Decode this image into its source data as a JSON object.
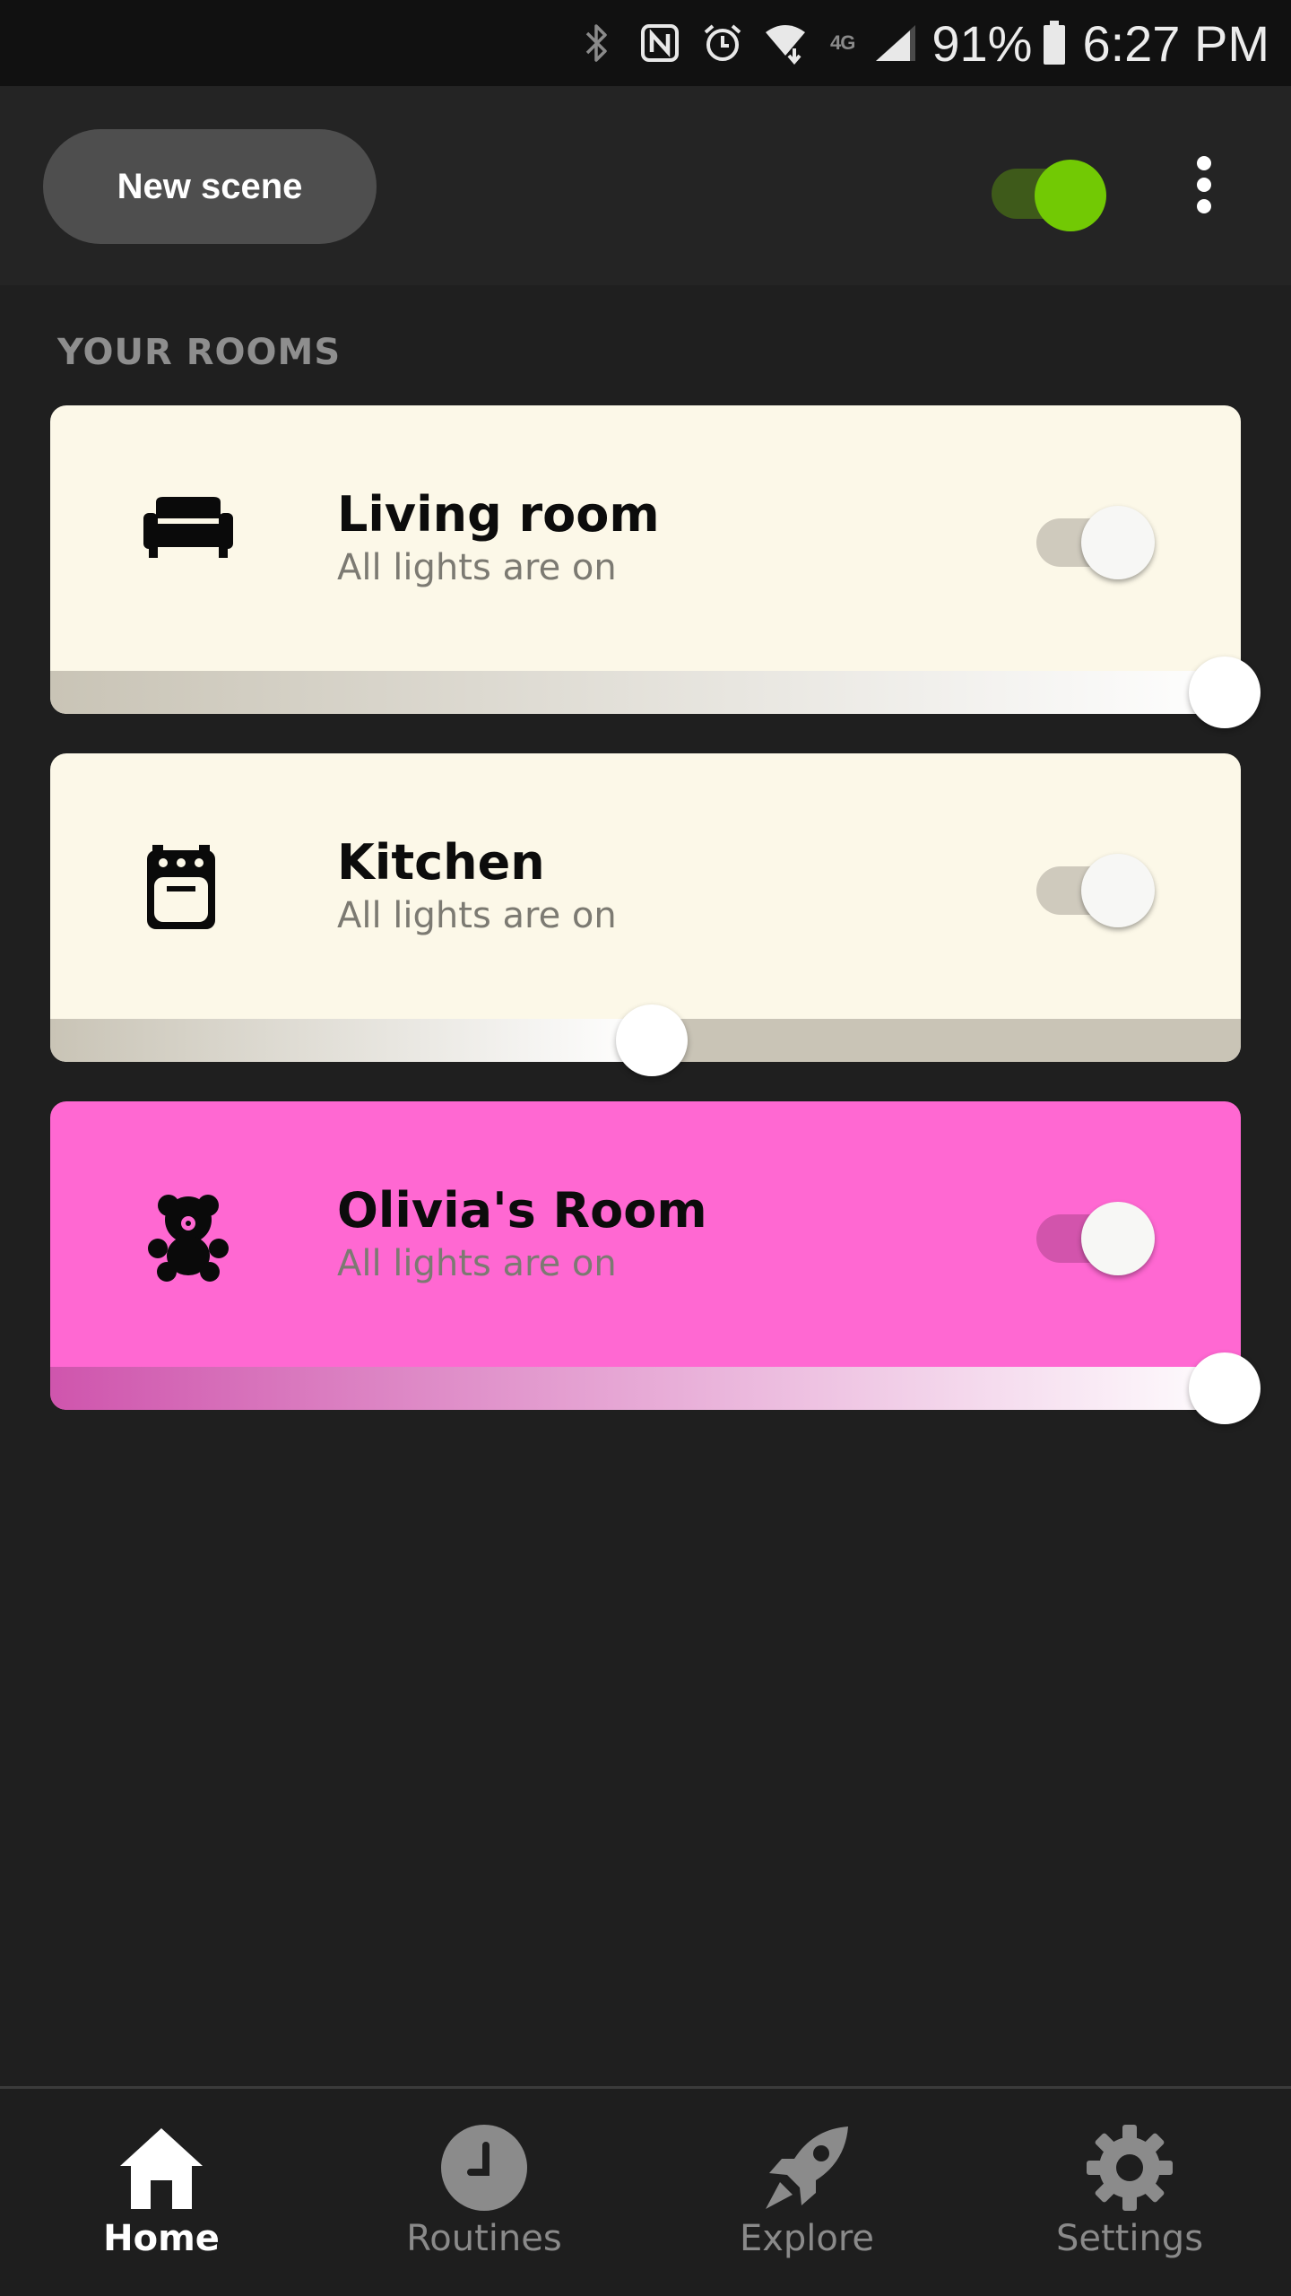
{
  "status_bar": {
    "network_type": "4G",
    "battery": "91%",
    "time": "6:27 PM",
    "icons": [
      "bluetooth-icon",
      "nfc-icon",
      "alarm-icon",
      "wifi-icon",
      "cell-signal-icon",
      "battery-icon"
    ]
  },
  "header": {
    "new_scene_label": "New scene",
    "master_toggle_on": true,
    "accent_color": "#72c904"
  },
  "rooms_section": {
    "title": "YOUR ROOMS",
    "rooms": [
      {
        "name": "Living room",
        "status": "All lights are on",
        "icon": "sofa-icon",
        "on": true,
        "brightness_percent": 100,
        "card_color": "#fcf8e8",
        "track_from": "#c9c4b6",
        "track_to": "#ffffff"
      },
      {
        "name": "Kitchen",
        "status": "All lights are on",
        "icon": "oven-icon",
        "on": true,
        "brightness_percent": 50,
        "card_color": "#fcf8e8",
        "track_from": "#c9c4b6",
        "track_to": "#ffffff"
      },
      {
        "name": "Olivia's Room",
        "status": "All lights are on",
        "icon": "teddy-bear-icon",
        "on": true,
        "brightness_percent": 100,
        "card_color": "#ff68d2",
        "track_from": "#cf55ad",
        "track_to": "#ffffff"
      }
    ]
  },
  "bottom_nav": {
    "items": [
      {
        "label": "Home",
        "icon": "home-icon",
        "active": true
      },
      {
        "label": "Routines",
        "icon": "clock-icon",
        "active": false
      },
      {
        "label": "Explore",
        "icon": "rocket-icon",
        "active": false
      },
      {
        "label": "Settings",
        "icon": "gear-icon",
        "active": false
      }
    ]
  }
}
